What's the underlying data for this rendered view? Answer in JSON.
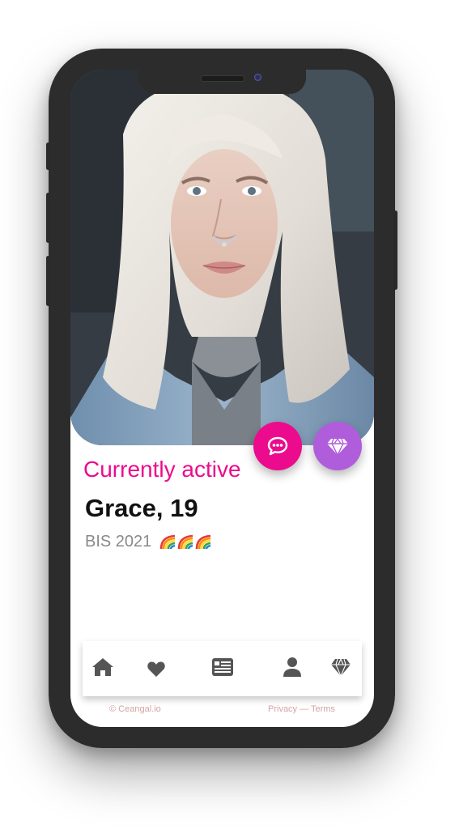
{
  "profile": {
    "status": "Currently active",
    "name_age": "Grace, 19",
    "subtitle": "BIS 2021",
    "badges": [
      "rainbow-icon",
      "rainbow-icon",
      "rainbow-icon"
    ]
  },
  "actions": {
    "chat_icon": "chat-bubble-icon",
    "premium_icon": "diamond-icon"
  },
  "nav": {
    "items": [
      "home-icon",
      "heart-icon",
      "news-icon",
      "user-icon",
      "diamond-icon"
    ]
  },
  "footer": {
    "copyright": "© Ceangal.io",
    "privacy": "Privacy",
    "separator": " — ",
    "terms": "Terms"
  },
  "colors": {
    "accent_pink": "#ec0b8c",
    "accent_purple": "#b05ddc",
    "nav_icon": "#555555",
    "footer_text": "#d4a3a3"
  }
}
